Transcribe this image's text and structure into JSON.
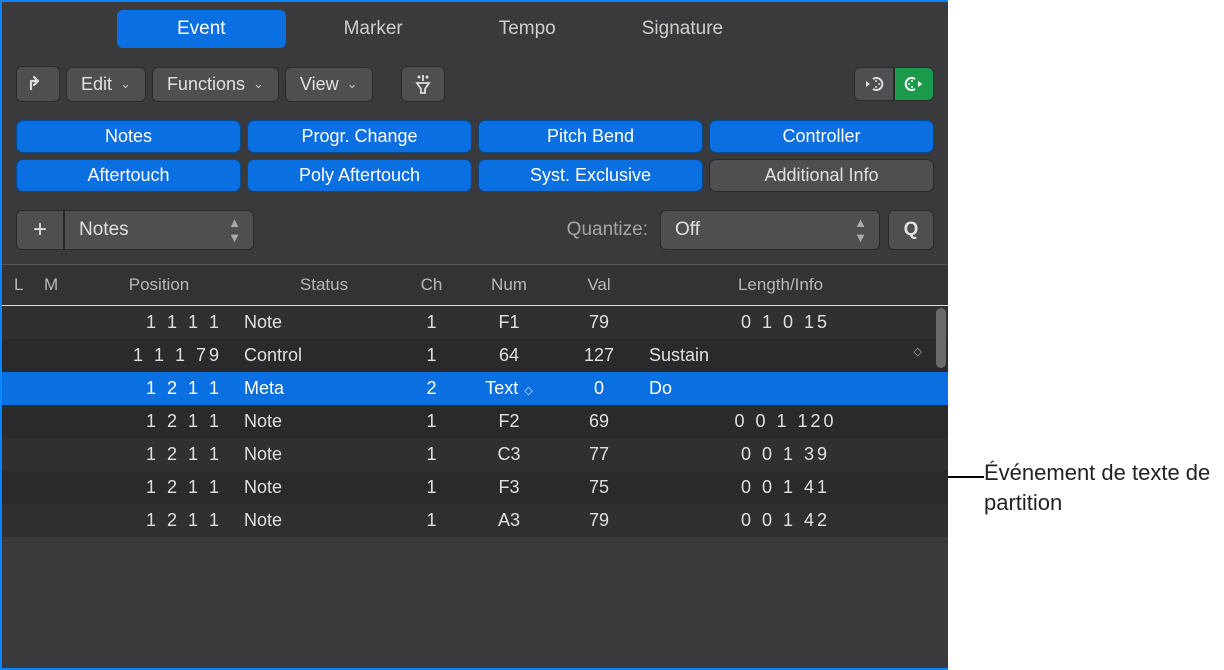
{
  "tabs": {
    "event": "Event",
    "marker": "Marker",
    "tempo": "Tempo",
    "signature": "Signature"
  },
  "toolbar": {
    "edit": "Edit",
    "functions": "Functions",
    "view": "View"
  },
  "filters": {
    "notes": "Notes",
    "progr_change": "Progr. Change",
    "pitch_bend": "Pitch Bend",
    "controller": "Controller",
    "aftertouch": "Aftertouch",
    "poly_aftertouch": "Poly Aftertouch",
    "syst_exclusive": "Syst. Exclusive",
    "additional_info": "Additional Info"
  },
  "addrow": {
    "type_select": "Notes",
    "quantize_label": "Quantize:",
    "quantize_value": "Off",
    "q_button": "Q"
  },
  "columns": {
    "l": "L",
    "m": "M",
    "position": "Position",
    "status": "Status",
    "ch": "Ch",
    "num": "Num",
    "val": "Val",
    "length_info": "Length/Info"
  },
  "rows": [
    {
      "position": "1 1 1    1",
      "status": "Note",
      "ch": "1",
      "num": "F1",
      "val": "79",
      "info": "0 1 0   15",
      "info_numeric": true
    },
    {
      "position": "1 1 1  79",
      "status": "Control",
      "ch": "1",
      "num": "64",
      "val": "127",
      "info": "Sustain",
      "has_stepper": true
    },
    {
      "position": "1 2 1    1",
      "status": "Meta",
      "ch": "2",
      "num": "Text",
      "num_has_stepper": true,
      "val": "0",
      "info": "Do",
      "selected": true
    },
    {
      "position": "1 2 1    1",
      "status": "Note",
      "ch": "1",
      "num": "F2",
      "val": "69",
      "info": "0 0 1 120",
      "info_numeric": true
    },
    {
      "position": "1 2 1    1",
      "status": "Note",
      "ch": "1",
      "num": "C3",
      "val": "77",
      "info": "0 0 1   39",
      "info_numeric": true
    },
    {
      "position": "1 2 1    1",
      "status": "Note",
      "ch": "1",
      "num": "F3",
      "val": "75",
      "info": "0 0 1   41",
      "info_numeric": true
    },
    {
      "position": "1 2 1    1",
      "status": "Note",
      "ch": "1",
      "num": "A3",
      "val": "79",
      "info": "0 0 1   42",
      "info_numeric": true
    }
  ],
  "annotation": "Événement de texte de partition"
}
